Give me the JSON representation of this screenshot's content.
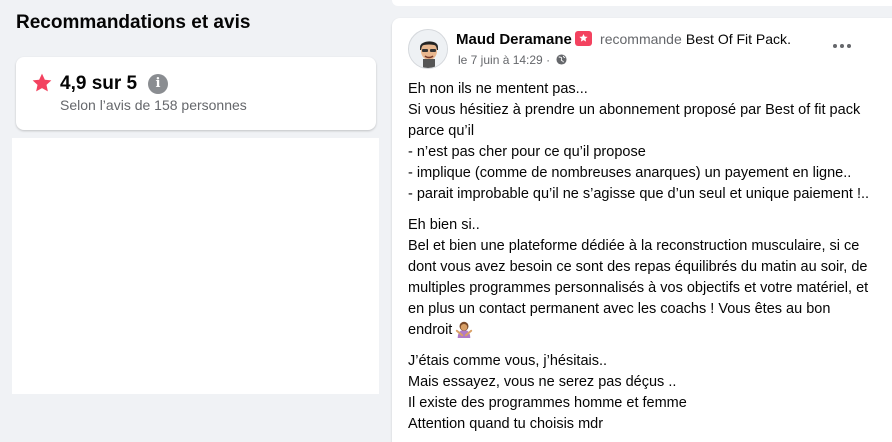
{
  "section": {
    "title": "Recommandations et avis"
  },
  "rating": {
    "value": "4,9 sur 5",
    "info_glyph": "i",
    "subtitle": "Selon l’avis de 158 personnes",
    "star_icon": "star-icon",
    "star_color": "#f3425f"
  },
  "post": {
    "author": "Maud Deramane",
    "action": "recommande",
    "page": "Best Of Fit Pack",
    "date": "le 7 juin à 14:29 ·",
    "paragraphs": [
      {
        "lines": [
          "Eh non ils ne mentent pas...",
          "Si vous hésitiez à prendre un abonnement proposé par Best of fit pack parce qu’il",
          "- n’est pas cher pour ce qu’il propose",
          "- implique (comme de nombreuses anarques) un payement en ligne..",
          "- parait improbable qu’il ne s’agisse que d’un seul et unique paiement !.."
        ]
      },
      {
        "lines": [
          "Eh bien si..",
          "Bel et bien une plateforme dédiée à la reconstruction musculaire, si ce dont vous avez besoin ce sont des repas équilibrés du matin au soir, de multiples programmes personnalisés à vos objectifs et votre matériel, et en plus un contact permanent avec les coachs ! Vous êtes au bon endroit"
        ]
      },
      {
        "lines": [
          "J’étais comme vous, j’hésitais..",
          "Mais essayez, vous ne serez pas déçus ..",
          "Il existe des programmes homme et femme",
          "Attention quand tu choisis mdr"
        ]
      }
    ],
    "emoji_icon": "woman-gesturing-emoji"
  },
  "colors": {
    "background": "#f0f2f5",
    "card": "#ffffff",
    "secondary_text": "#65676b",
    "accent_red": "#f3425f"
  }
}
